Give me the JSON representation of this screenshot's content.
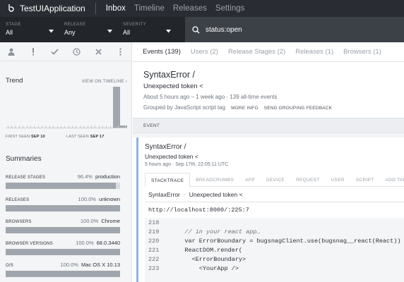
{
  "app": {
    "name": "TestUIApplication"
  },
  "nav": {
    "items": [
      "Inbox",
      "Timeline",
      "Releases",
      "Settings"
    ]
  },
  "filters": [
    {
      "label": "STAGE",
      "value": "All"
    },
    {
      "label": "RELEASE",
      "value": "Any"
    },
    {
      "label": "SEVERITY",
      "value": "All"
    }
  ],
  "search": {
    "value": "status:open"
  },
  "sidebar": {
    "trend": {
      "title": "Trend",
      "link": "VIEW ON TIMELINE ›",
      "first_seen_label": "FIRST SEEN",
      "first_seen": "SEP 10",
      "last_seen_label": "LAST SEEN",
      "last_seen": "SEP 17",
      "bars": [
        0,
        0,
        0,
        0,
        0,
        0,
        0,
        0,
        0,
        0,
        0,
        0,
        0,
        0,
        0,
        0,
        0,
        0,
        0,
        0,
        0,
        0,
        0,
        0,
        0,
        0,
        0,
        0,
        1.0,
        0,
        0.06,
        0
      ]
    },
    "summaries_title": "Summaries",
    "summaries": [
      {
        "key": "RELEASE STAGES",
        "pct": "96.4%",
        "value": "production",
        "fraction": 0.964
      },
      {
        "key": "RELEASES",
        "pct": "100.0%",
        "value": "unknown",
        "fraction": 1.0
      },
      {
        "key": "BROWSERS",
        "pct": "100.0%",
        "value": "Chrome",
        "fraction": 1.0
      },
      {
        "key": "BROWSER VERSIONS",
        "pct": "100.0%",
        "value": "68.0.3440",
        "fraction": 1.0
      },
      {
        "key": "O/S",
        "pct": "100.0%",
        "value": "Mac OS X 10.13",
        "fraction": 1.0
      }
    ]
  },
  "tabs": [
    "Events (139)",
    "Users (2)",
    "Release Stages (2)",
    "Releases (1)",
    "Browsers (1)"
  ],
  "error": {
    "title": "SyntaxError  /",
    "message": "Unexpected token <",
    "meta": "About 5 hours ago – 1 week ago · 139 all-time events",
    "grouped": "Grouped by JavaScript script tag",
    "more_info": "MORE INFO",
    "feedback": "SEND GROUPING FEEDBACK"
  },
  "event": {
    "section_label": "EVENT",
    "title": "SyntaxError  /",
    "message": "Unexpected token <",
    "meta": "5 hours ago · Sep 17th, 22:05:11 UTC",
    "tabs": [
      "STACKTRACE",
      "BREADCRUMBS",
      "APP",
      "DEVICE",
      "REQUEST",
      "USER",
      "SCRIPT",
      "ADD TAB +"
    ],
    "frame": {
      "error": "SyntaxError",
      "sep": "·",
      "message": "Unexpected token <"
    },
    "file": "http://localhost:8000/:225:7",
    "code": [
      {
        "n": "218",
        "text": "",
        "comment": false
      },
      {
        "n": "219",
        "text": "    // in your react app…",
        "comment": true
      },
      {
        "n": "220",
        "text": "    var ErrorBoundary = bugsnagClient.use(bugsnag__react(React))",
        "comment": false
      },
      {
        "n": "221",
        "text": "    ReactDOM.render(",
        "comment": false
      },
      {
        "n": "222",
        "text": "      <ErrorBoundary>",
        "comment": false
      },
      {
        "n": "223",
        "text": "        <YourApp />",
        "comment": false
      }
    ]
  }
}
